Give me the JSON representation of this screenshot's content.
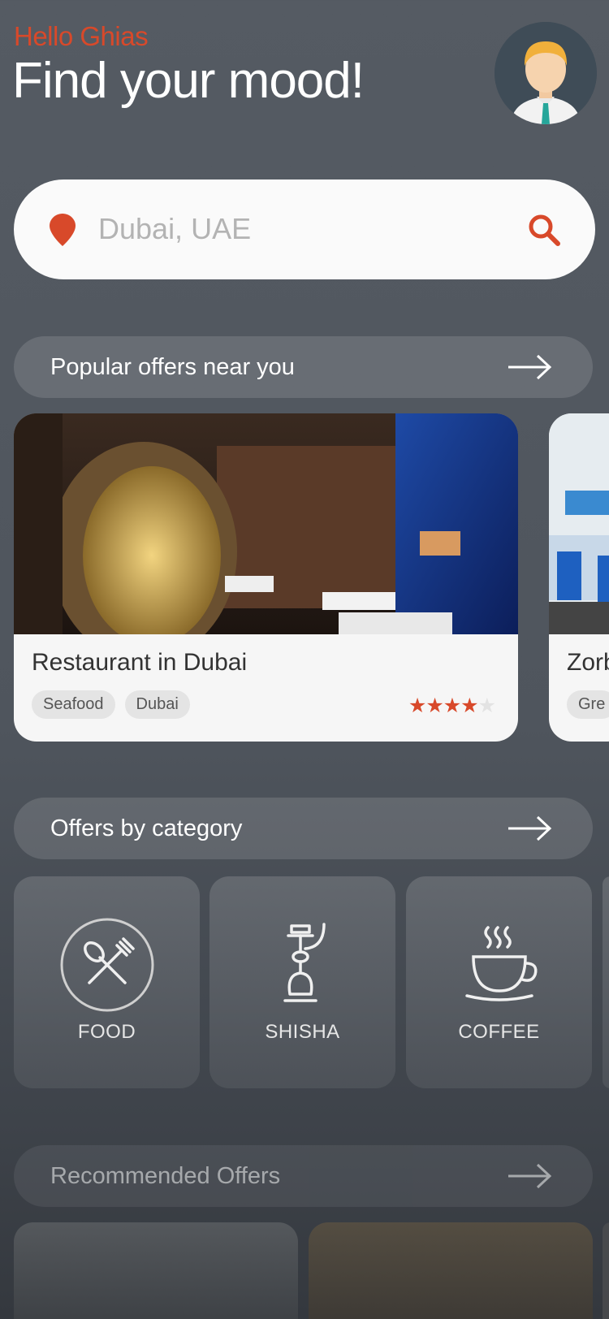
{
  "header": {
    "greeting": "Hello Ghias",
    "headline": "Find your mood!"
  },
  "search": {
    "placeholder": "Dubai, UAE",
    "pin_icon": "location-pin-icon",
    "search_icon": "search-icon"
  },
  "sections": {
    "popular": "Popular offers near you",
    "category": "Offers by category",
    "recommended": "Recommended Offers"
  },
  "popular_offers": [
    {
      "title": "Restaurant in Dubai",
      "tags": [
        "Seafood",
        "Dubai"
      ],
      "rating": 4,
      "rating_max": 5
    },
    {
      "title": "Zorb",
      "tags": [
        "Gre"
      ]
    }
  ],
  "categories": [
    {
      "label": "FOOD",
      "icon": "fork-spoon-icon"
    },
    {
      "label": "SHISHA",
      "icon": "shisha-icon"
    },
    {
      "label": "COFFEE",
      "icon": "coffee-cup-icon"
    }
  ],
  "colors": {
    "accent": "#d8492a",
    "background": "#52585f",
    "card": "#f6f6f6"
  }
}
